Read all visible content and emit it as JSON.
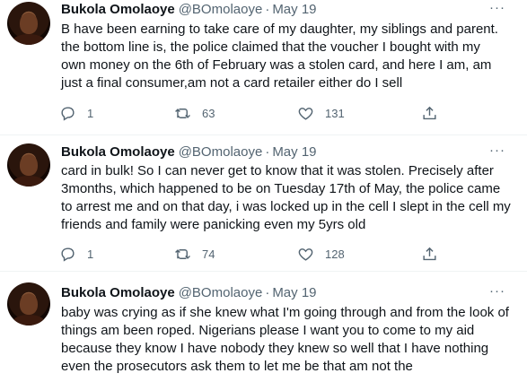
{
  "tweets": [
    {
      "author_name": "Bukola Omolaoye",
      "handle": "@BOmolaoye",
      "separator": "·",
      "date": "May 19",
      "more": "···",
      "lines": [
        "B have been earning to take care of my daughter, my siblings and parent.",
        "the bottom line is,  the police claimed that the voucher I bought with my",
        "own money on the 6th of February was a stolen card, and here I am, am",
        "just a final consumer,am not a card retailer either do I sell"
      ],
      "replies": "1",
      "retweets": "63",
      "likes": "131"
    },
    {
      "author_name": "Bukola Omolaoye",
      "handle": "@BOmolaoye",
      "separator": "·",
      "date": "May 19",
      "more": "···",
      "lines": [
        "card in bulk! So I can never get to know that it was stolen.  Precisely after",
        "3months, which happened to be on Tuesday 17th of May, the police came",
        "to arrest me and on that day, i was locked up in the cell I slept in the cell my",
        "friends and family were panicking even my 5yrs old"
      ],
      "replies": "1",
      "retweets": "74",
      "likes": "128"
    },
    {
      "author_name": "Bukola Omolaoye",
      "handle": "@BOmolaoye",
      "separator": "·",
      "date": "May 19",
      "more": "···",
      "lines": [
        "baby was crying as if she knew what I'm going through and from the look of",
        "things am been roped. Nigerians please I want you to come to my aid",
        "because they know I have nobody they knew so well that I have nothing",
        "even the prosecutors  ask them to let me be that am not the"
      ]
    }
  ],
  "icons": {
    "reply": "reply-icon",
    "retweet": "retweet-icon",
    "like": "heart-icon",
    "share": "share-icon"
  },
  "colors": {
    "secondary_text": "#536471",
    "primary_text": "#0f1419",
    "divider": "#eff3f4"
  }
}
